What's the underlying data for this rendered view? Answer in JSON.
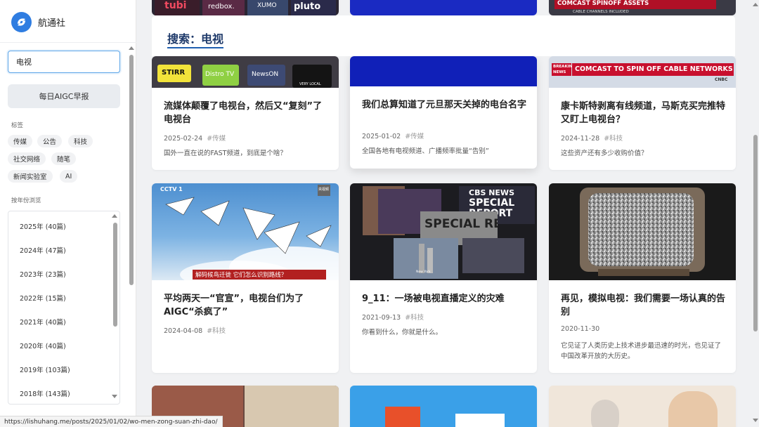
{
  "sidebar": {
    "brand": "航通社",
    "search": {
      "value": "电视",
      "placeholder": ""
    },
    "aigc_button": "每日AIGC早报",
    "tags_heading": "标签",
    "tags": [
      "传媒",
      "公告",
      "科技",
      "社交网络",
      "随笔",
      "新闻实验室",
      "AI"
    ],
    "years_heading": "按年份浏览",
    "years": [
      "2025年 (40篇)",
      "2024年 (47篇)",
      "2023年 (23篇)",
      "2022年 (15篇)",
      "2021年 (40篇)",
      "2020年 (40篇)",
      "2019年 (103篇)",
      "2018年 (143篇)"
    ]
  },
  "main": {
    "search_title": "搜索：电视",
    "top_thumb_texts": {
      "tubi": "tubi",
      "redbox": "redbox.",
      "xumo": "XUMO",
      "pluto": "pluto",
      "comcast_top": "COMCAST SPINOFF ASSETS",
      "comcast_top_sub": "CABLE CHANNELS INCLUDED"
    },
    "thumb_texts": {
      "stirr": "STIRR",
      "distro": "Distro TV",
      "newson": "NewsON",
      "verylocal": "VERY LOCAL",
      "breaking": "BREAKING",
      "news": "NEWS",
      "comcast_banner": "COMCAST TO SPIN OFF CABLE NETWORKS",
      "cnbc": "CNBC",
      "cctv": "CCTV 1",
      "cctv_corner": "央视频",
      "crane_caption": "解码候鸟迁徙 它们怎么识别路线？",
      "cbs_news": "CBS NEWS",
      "special": "SPECIAL",
      "report": "REPORT",
      "sp_report": "SPECIAL REPORT",
      "news_york": "New York"
    },
    "cards": [
      {
        "title": "流媒体颠覆了电视台，然后又“复刻”了电视台",
        "date": "2025-02-24",
        "tag": "#传媒",
        "desc": "国外一直在说的FAST频道，到底是个啥？"
      },
      {
        "title": "我们总算知道了元旦那天关掉的电台名字",
        "date": "2025-01-02",
        "tag": "#传媒",
        "desc": "全国各地有电视频道、广播频率批量“告别”"
      },
      {
        "title": "康卡斯特剥离有线频道，马斯克买完推特又盯上电视台？",
        "date": "2024-11-28",
        "tag": "#科技",
        "desc": "这些资产还有多少收购价值？"
      },
      {
        "title": "平均两天一“官宣”，电视台们为了AIGC“杀疯了”",
        "date": "2024-04-08",
        "tag": "#科技",
        "desc": ""
      },
      {
        "title": "9_11：一场被电视直播定义的灾难",
        "date": "2021-09-13",
        "tag": "#科技",
        "desc": "你看到什么，你就是什么。"
      },
      {
        "title": "再见，模拟电视：我们需要一场认真的告别",
        "date": "2020-11-30",
        "tag": "",
        "desc": "它见证了人类历史上技术进步最迅速的时光，也见证了中国改革开放的大历史。"
      }
    ]
  },
  "status_url": "https://lishuhang.me/posts/2025/01/02/wo-men-zong-suan-zhi-dao/",
  "colors": {
    "accent": "#2f7de1",
    "title_underline": "#1f5fb0",
    "comcast_red": "#c8102e",
    "blue_thumb": "#1020b8"
  }
}
